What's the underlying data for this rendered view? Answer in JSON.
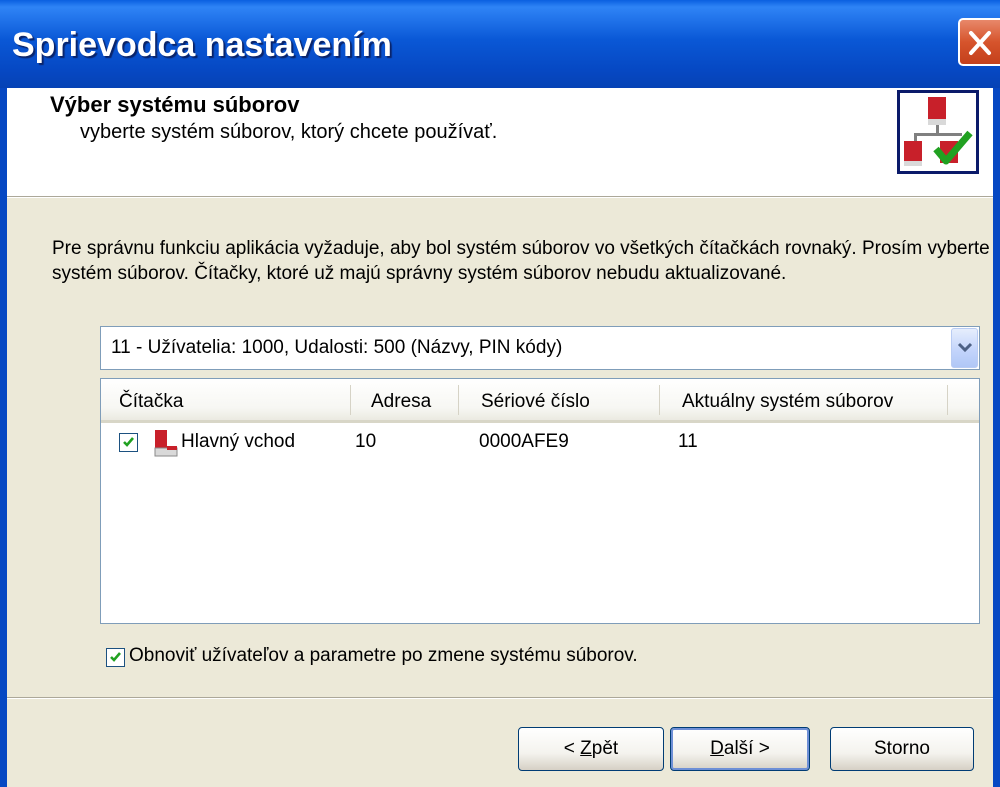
{
  "window": {
    "title": "Sprievodca nastavením"
  },
  "header": {
    "title": "Výber systému súborov",
    "subtitle": "vyberte systém súborov, ktorý chcete používať."
  },
  "description": "Pre správnu funkciu aplikácia vyžaduje, aby bol systém súborov vo všetkých čítačkách rovnaký. Prosím vyberte systém súborov. Čítačky, ktoré už majú správny systém súborov nebudu aktualizované.",
  "file_system_select": {
    "selected": "11 - Užívatelia: 1000, Udalosti: 500 (Názvy, PIN kódy)"
  },
  "reader_list": {
    "columns": [
      "Čítačka",
      "Adresa",
      "Sériové číslo",
      "Aktuálny systém súborov"
    ],
    "rows": [
      {
        "checked": true,
        "icon": "reader-icon",
        "name": "Hlavný vchod",
        "address": "10",
        "serial": "0000AFE9",
        "file_system": "11"
      }
    ]
  },
  "refresh_option": {
    "checked": true,
    "label": "Obnoviť užívateľov a parametre po zmene systému súborov."
  },
  "buttons": {
    "back_prefix": "< ",
    "back_mnemonic": "Z",
    "back_rest": "pět",
    "next_mnemonic": "D",
    "next_rest": "alší >",
    "cancel": "Storno"
  },
  "colors": {
    "titlebar": "#0a58d6",
    "dialog_background": "#ece9d8",
    "check_mark": "#21a121",
    "reader_icon": "#c8202a"
  }
}
